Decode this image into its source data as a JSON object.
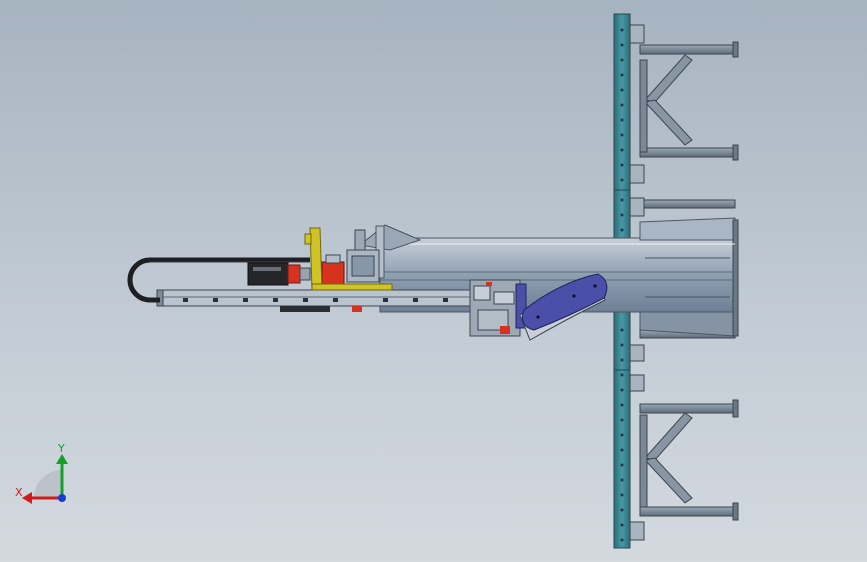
{
  "viewport": {
    "background_top": "#a6b3c0",
    "background_bottom": "#d3d9df"
  },
  "colors": {
    "column": "#3d8390",
    "beam_steel": "#7e8fa3",
    "beam_light": "#b5c1cd",
    "frame_dark": "#4a5663",
    "motor_red": "#d6321e",
    "bracket_yellow": "#cfc326",
    "gripper_blue": "#4b4fa8",
    "cable_black": "#1e1f22"
  },
  "triad": {
    "x_label": "X",
    "y_label": "Y",
    "x_color": "#d11a1a",
    "y_color": "#15a02b",
    "z_color": "#1a3bd1"
  }
}
